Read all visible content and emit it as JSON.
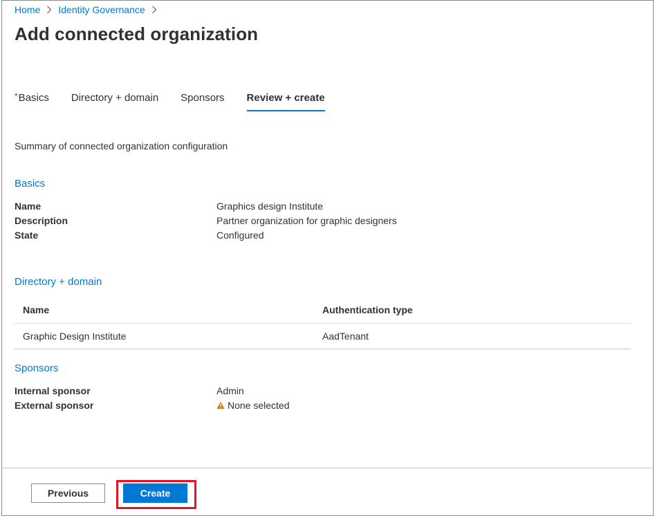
{
  "breadcrumb": {
    "home": "Home",
    "identity_governance": "Identity Governance"
  },
  "page_title": "Add connected organization",
  "tabs": [
    {
      "label": "Basics",
      "required": true
    },
    {
      "label": "Directory + domain"
    },
    {
      "label": "Sponsors"
    },
    {
      "label": "Review + create",
      "active": true
    }
  ],
  "summary": "Summary of connected organization configuration",
  "basics": {
    "heading": "Basics",
    "rows": [
      {
        "key": "Name",
        "value": "Graphics design Institute"
      },
      {
        "key": "Description",
        "value": "Partner organization for graphic designers"
      },
      {
        "key": "State",
        "value": "Configured"
      }
    ]
  },
  "directory": {
    "heading": "Directory + domain",
    "columns": [
      "Name",
      "Authentication type"
    ],
    "rows": [
      [
        "Graphic Design Institute",
        "AadTenant"
      ]
    ]
  },
  "sponsors": {
    "heading": "Sponsors",
    "rows": [
      {
        "key": "Internal sponsor",
        "value": "Admin"
      },
      {
        "key": "External sponsor",
        "value": "None selected",
        "icon": "warning-icon"
      }
    ]
  },
  "footer": {
    "previous_label": "Previous",
    "create_label": "Create"
  },
  "colors": {
    "accent": "#0078d4",
    "warning": "#d47500",
    "highlight": "#e81123",
    "required": "#a4262c"
  }
}
